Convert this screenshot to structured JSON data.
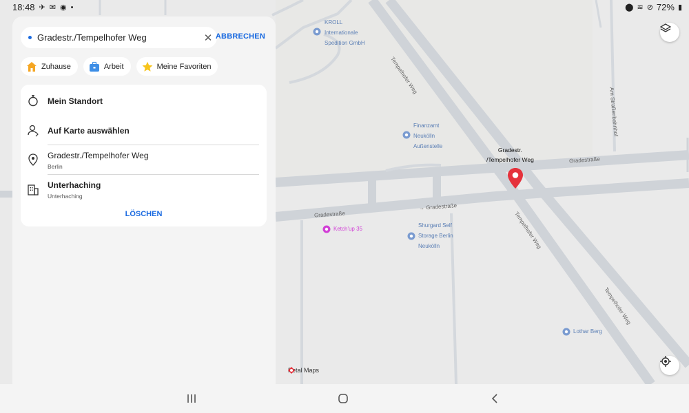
{
  "status_bar": {
    "time": "18:48",
    "battery": "72%"
  },
  "search": {
    "query": "Gradestr./Tempelhofer Weg",
    "cancel_label": "ABBRECHEN"
  },
  "chips": [
    {
      "label": "Zuhause",
      "icon": "home-icon"
    },
    {
      "label": "Arbeit",
      "icon": "briefcase-icon"
    },
    {
      "label": "Meine Favoriten",
      "icon": "star-icon"
    }
  ],
  "suggestions": {
    "my_location": "Mein Standort",
    "pick_on_map": "Auf Karte auswählen",
    "history": [
      {
        "title": "Gradestr./Tempelhofer Weg",
        "subtitle": "Berlin"
      },
      {
        "title": "Unterhaching",
        "subtitle": "Unterhaching"
      }
    ],
    "clear_label": "LÖSCHEN"
  },
  "map": {
    "pois": [
      {
        "name": "KROLL\nInternationale\nSpedition GmbH",
        "color": "#5b7fb5"
      },
      {
        "name": "Finanzamt\nNeukölln\nAußenstelle",
        "color": "#5b7fb5"
      },
      {
        "name": "Ketch'up 35",
        "color": "#d13fd6"
      },
      {
        "name": "Shurgard Self\nStorage Berlin\nNeukölln",
        "color": "#5b7fb5"
      },
      {
        "name": "Lothar Berg",
        "color": "#5b7fb5"
      }
    ],
    "streets": {
      "tempelhofer_weg": "Tempelhofer Weg",
      "gradestrasse": "Gradestraße",
      "gradestrasse_arrow": "→ Gradestraße",
      "am_strassenbahnhof": "Am Straßenbahnhof"
    },
    "selected_pin_label": "Gradestr.\n/Tempelhofer Weg",
    "logo_text": "Petal Maps",
    "pin_color": "#e5323c",
    "accent_color": "#1a6ae0"
  }
}
